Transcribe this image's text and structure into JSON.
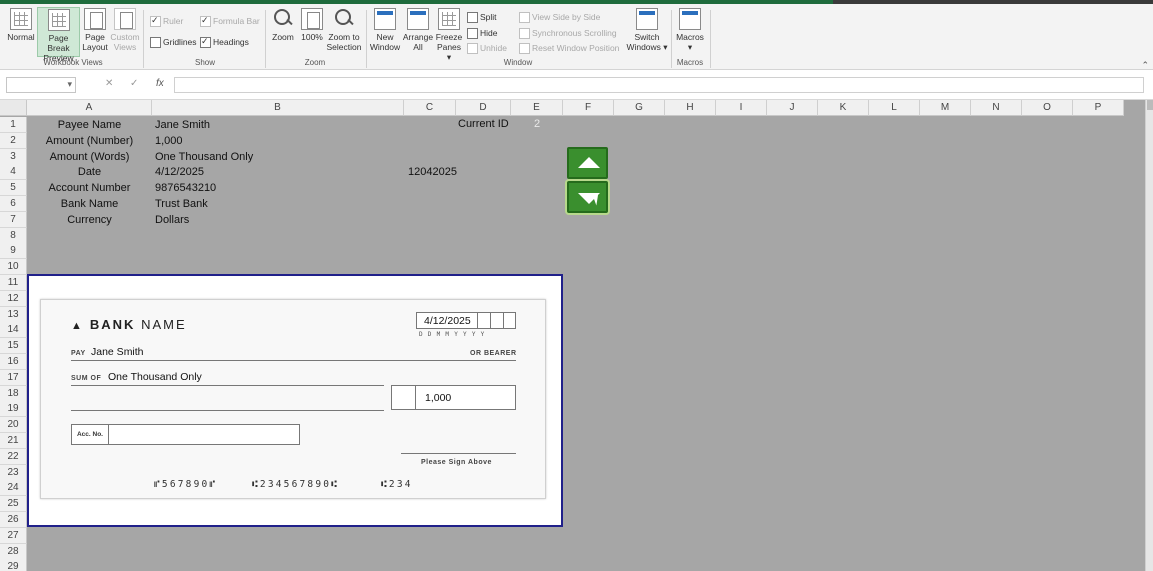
{
  "ribbon": {
    "workbook_views": {
      "group_label": "Workbook Views",
      "normal": "Normal",
      "page_break_1": "Page Break",
      "page_break_2": "Preview",
      "page_layout_1": "Page",
      "page_layout_2": "Layout",
      "custom_1": "Custom",
      "custom_2": "Views"
    },
    "show": {
      "group_label": "Show",
      "ruler": "Ruler",
      "formula_bar": "Formula Bar",
      "gridlines": "Gridlines",
      "headings": "Headings"
    },
    "zoom": {
      "group_label": "Zoom",
      "zoom": "Zoom",
      "hundred": "100%",
      "zoom_sel_1": "Zoom to",
      "zoom_sel_2": "Selection"
    },
    "window": {
      "group_label": "Window",
      "new_1": "New",
      "new_2": "Window",
      "arrange_1": "Arrange",
      "arrange_2": "All",
      "freeze_1": "Freeze",
      "freeze_2": "Panes",
      "split": "Split",
      "hide": "Hide",
      "unhide": "Unhide",
      "side_by_side": "View Side by Side",
      "sync_scroll": "Synchronous Scrolling",
      "reset_pos": "Reset Window Position",
      "switch_1": "Switch",
      "switch_2": "Windows"
    },
    "macros": {
      "group_label": "Macros",
      "macros": "Macros"
    }
  },
  "formula_bar": {
    "fx": "fx",
    "cancel": "✕",
    "enter": "✓"
  },
  "columns": [
    "A",
    "B",
    "C",
    "D",
    "E",
    "F",
    "G",
    "H",
    "I",
    "J",
    "K",
    "L",
    "M",
    "N",
    "O",
    "P"
  ],
  "rows": [
    "1",
    "2",
    "3",
    "4",
    "5",
    "6",
    "7",
    "8",
    "9",
    "10",
    "11",
    "12",
    "13",
    "14",
    "15",
    "16",
    "17",
    "18",
    "19",
    "20",
    "21",
    "22",
    "23",
    "24",
    "25",
    "26",
    "27",
    "28",
    "29"
  ],
  "cells": {
    "labels": [
      "Payee Name",
      "Amount (Number)",
      "Amount (Words)",
      "Date",
      "Account Number",
      "Bank Name",
      "Currency"
    ],
    "values": [
      "Jane Smith",
      "1,000",
      "One Thousand  Only",
      "4/12/2025",
      "9876543210",
      "Trust Bank",
      "Dollars"
    ],
    "c4": "12042025",
    "current_id_label": "Current ID",
    "current_id_value": "2"
  },
  "cheque": {
    "bank_bold": "BANK",
    "bank_rest": "NAME",
    "date": "4/12/2025",
    "date_labels": "DDMMYYYY",
    "pay_label": "PAY",
    "payee": "Jane Smith",
    "or_bearer": "OR BEARER",
    "sum_label": "SUM OF",
    "sum_words": "One Thousand  Only",
    "amount": "1,000",
    "acc_label": "Acc. No.",
    "sign": "Please Sign Above",
    "micr_1": "⑈567890⑈",
    "micr_2": "⑆234567890⑆",
    "micr_3": "⑆234"
  }
}
